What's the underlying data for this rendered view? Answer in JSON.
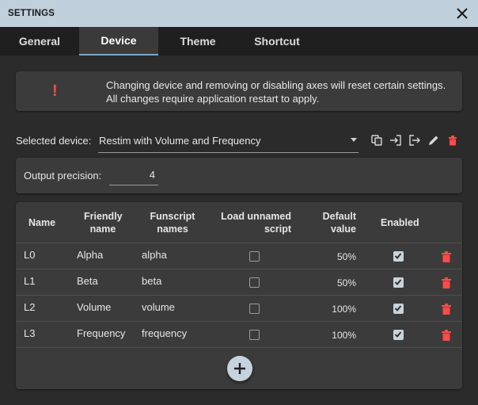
{
  "window": {
    "title": "SETTINGS"
  },
  "tabs": [
    {
      "label": "General"
    },
    {
      "label": "Device",
      "active": true
    },
    {
      "label": "Theme"
    },
    {
      "label": "Shortcut"
    }
  ],
  "warning": {
    "icon": "exclamation-icon",
    "line1": "Changing device and removing or disabling axes will reset certain settings.",
    "line2": "All changes require application restart to apply."
  },
  "device": {
    "label": "Selected device:",
    "selected": "Restim with Volume and Frequency",
    "tools": [
      "copy-icon",
      "import-icon",
      "export-icon",
      "edit-icon",
      "delete-icon"
    ]
  },
  "precision": {
    "label": "Output precision:",
    "value": "4"
  },
  "axes": {
    "headers": {
      "name": "Name",
      "friendly_1": "Friendly",
      "friendly_2": "name",
      "funscript_1": "Funscript",
      "funscript_2": "names",
      "load_1": "Load unnamed",
      "load_2": "script",
      "default_1": "Default",
      "default_2": "value",
      "enabled": "Enabled"
    },
    "rows": [
      {
        "name": "L0",
        "friendly": "Alpha",
        "funscript": "alpha",
        "load_unnamed": false,
        "default": "50%",
        "enabled": true
      },
      {
        "name": "L1",
        "friendly": "Beta",
        "funscript": "beta",
        "load_unnamed": false,
        "default": "50%",
        "enabled": true
      },
      {
        "name": "L2",
        "friendly": "Volume",
        "funscript": "volume",
        "load_unnamed": false,
        "default": "100%",
        "enabled": true
      },
      {
        "name": "L3",
        "friendly": "Frequency",
        "funscript": "frequency",
        "load_unnamed": false,
        "default": "100%",
        "enabled": true
      }
    ]
  },
  "colors": {
    "accent": "#7fa6c6",
    "danger": "#ff4a4a",
    "titlebar": "#bfcfdc",
    "panel": "#3b3b3b"
  }
}
